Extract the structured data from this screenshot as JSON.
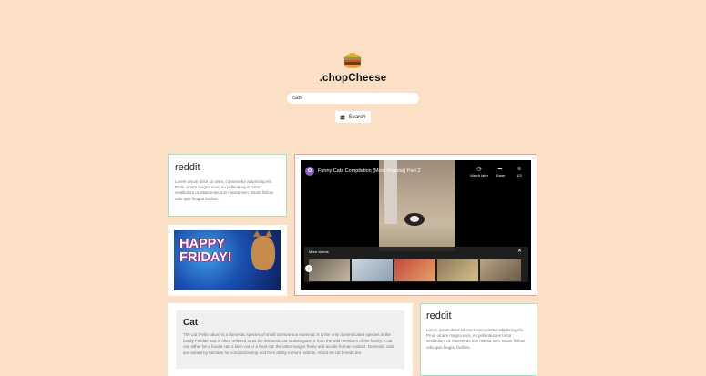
{
  "brand": {
    "name": ".chopCheese",
    "logo_icon": "burger-icon"
  },
  "search": {
    "value": "cats",
    "button_label": "Search",
    "button_icon": "search-icon"
  },
  "cards": {
    "reddit_1": {
      "title": "reddit",
      "body": "Lorem ipsum dolor sit amet, consectetur adipiscing elit. Proin ornare magna eros, eu pellentesque tortor vestibulum ut. Maecenas non massa sem. Etiam finibus odio quis feugiat facilisis."
    },
    "gif": {
      "text": "HAPPY FRIDAY!"
    },
    "video": {
      "title": "Funny Cats Compilation (Most Popular) Part 2",
      "actions": {
        "watch_later": "Watch later",
        "share": "Share",
        "playlist": "1/3"
      },
      "more_videos_label": "More videos"
    },
    "cat": {
      "title": "Cat",
      "body": "The cat (Felis catus) is a domestic species of small carnivorous mammal. It is the only domesticated species in the family Felidae and is often referred to as the domestic cat to distinguish it from the wild members of the family. A cat can either be a house cat, a farm cat or a feral cat; the latter ranges freely and avoids human contact. Domestic cats are valued by humans for companionship and their ability to hunt rodents. About 60 cat breeds are"
    },
    "reddit_2": {
      "title": "reddit",
      "body": "Lorem ipsum dolor sit amet, consectetur adipiscing elit. Proin ornare magna eros, eu pellentesque tortor vestibulum ut. Maecenas non massa sem. Etiam finibus odio quis feugiat facilisis."
    }
  },
  "colors": {
    "background": "#fbe0c5",
    "card_green_border": "#a6dfc3",
    "card_pink_border": "#ee9c9c"
  }
}
